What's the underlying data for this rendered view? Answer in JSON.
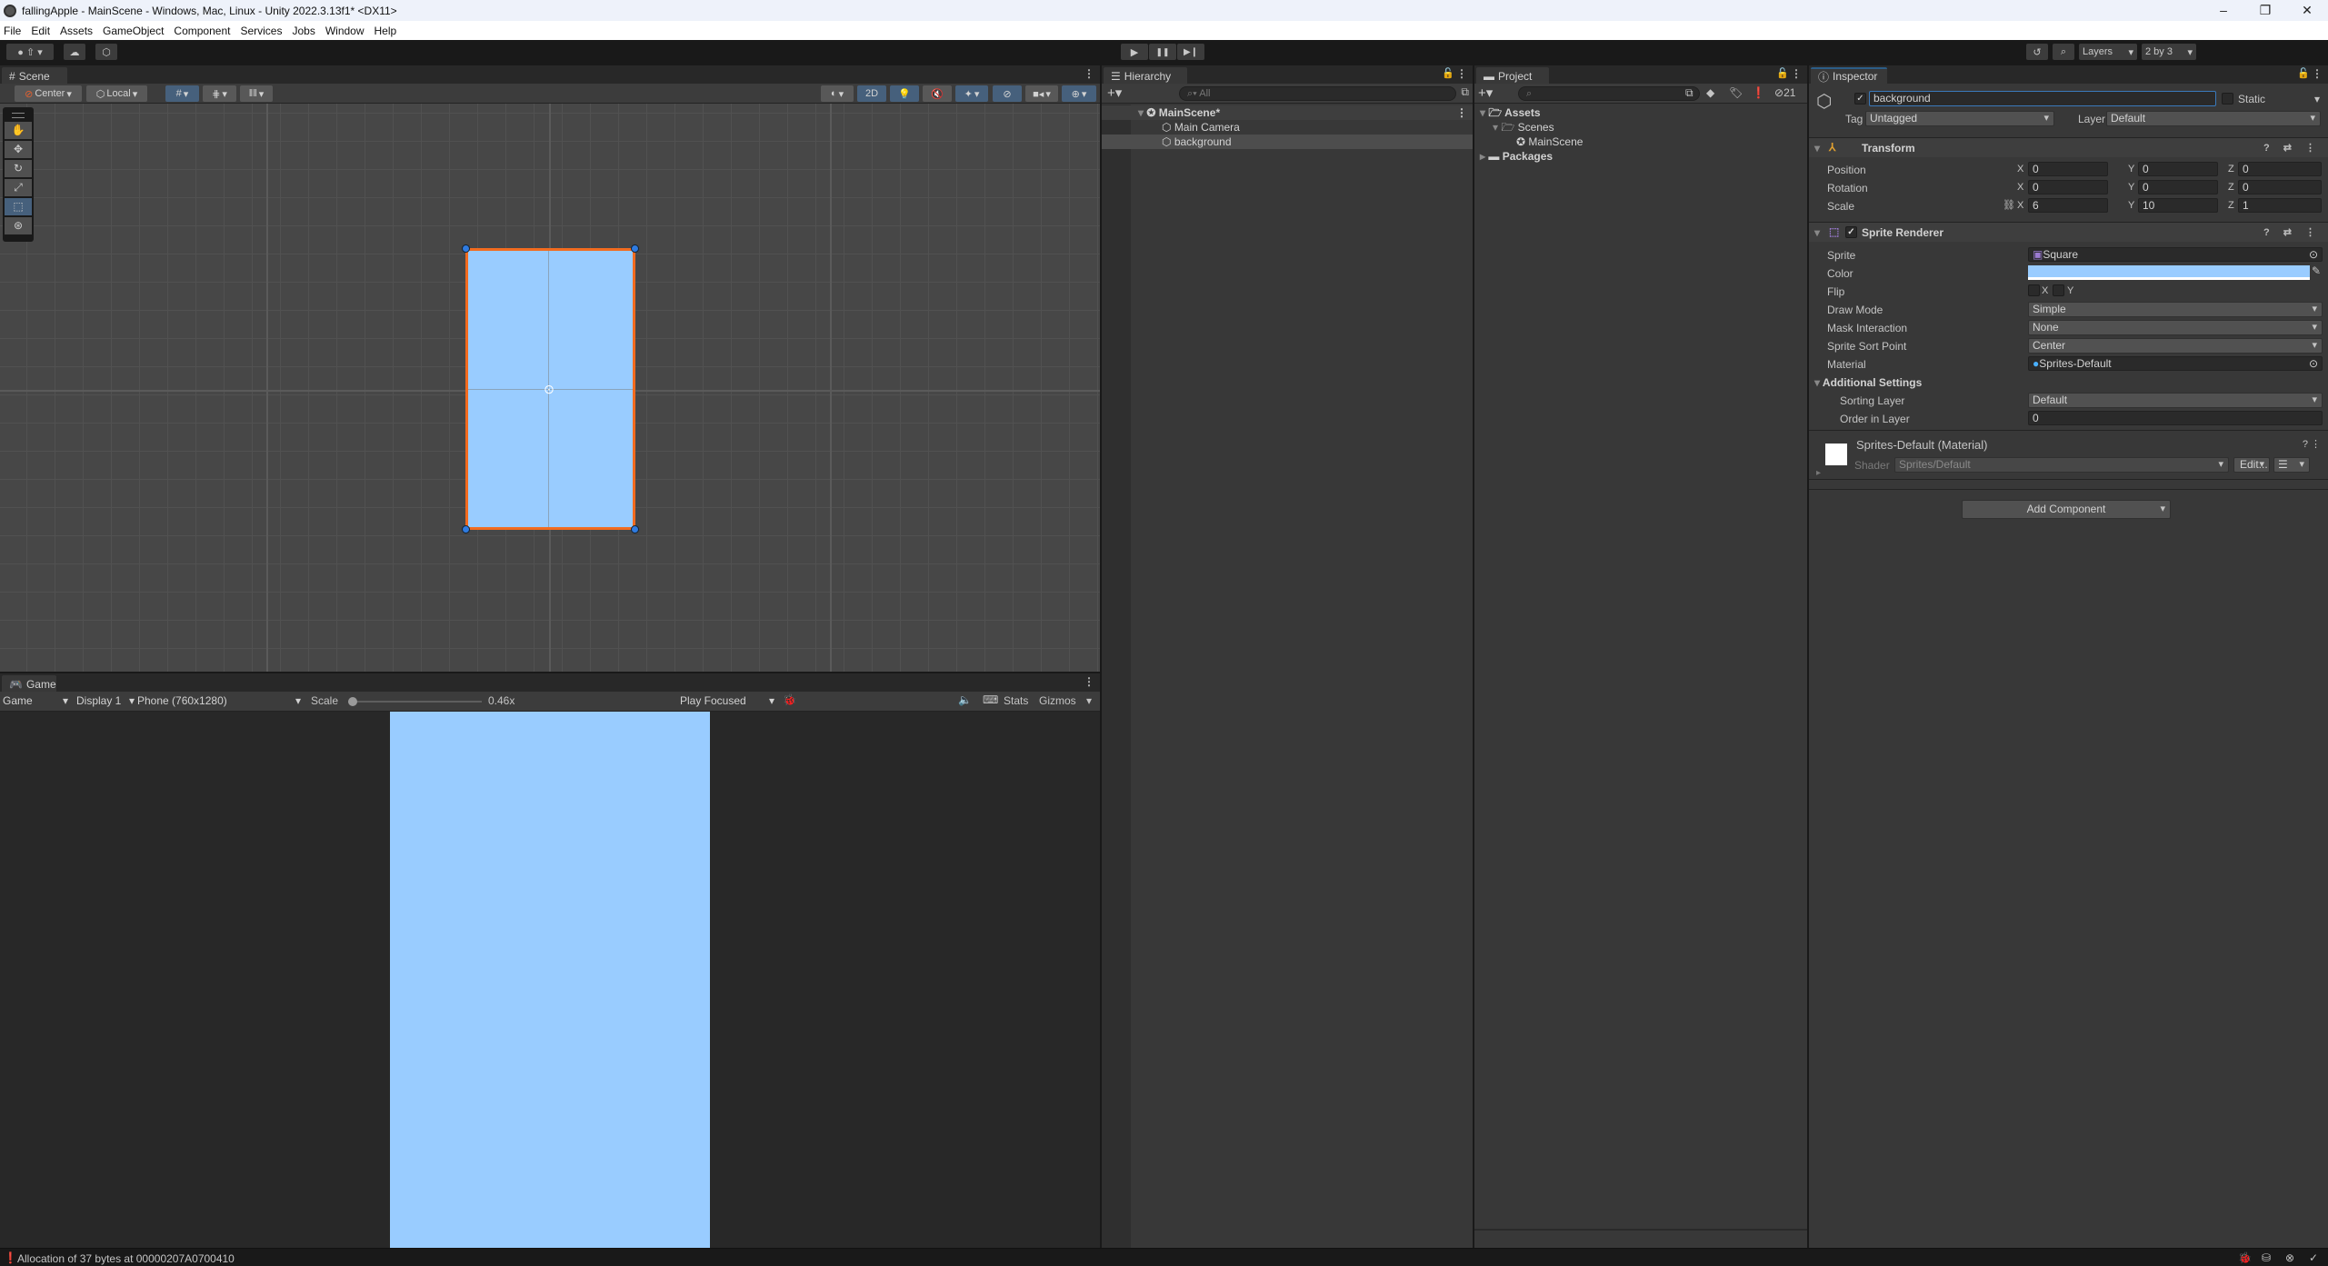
{
  "window": {
    "title": "fallingApple - MainScene - Windows, Mac, Linux - Unity 2022.3.13f1* <DX11>",
    "controls": {
      "minimize": "–",
      "maximize": "❐",
      "close": "✕"
    }
  },
  "menu": [
    "File",
    "Edit",
    "Assets",
    "GameObject",
    "Component",
    "Services",
    "Jobs",
    "Window",
    "Help"
  ],
  "toolbar": {
    "account_icon": "account-icon",
    "cloud_icon": "cloud-icon",
    "play_glyph": "▶",
    "pause_glyph": "❚❚",
    "step_glyph": "▶❙",
    "layers_label": "Layers",
    "layout_label": "2 by 3"
  },
  "scene": {
    "tab_label": "Scene",
    "pivot_label": "Center",
    "space_label": "Local",
    "mode_2d_label": "2D",
    "sprite_color": "#99ccff",
    "selection_color": "#f26b1f"
  },
  "game": {
    "tab_label": "Game",
    "view_dropdown": "Game",
    "display_dropdown": "Display 1",
    "resolution_dropdown": "Phone (760x1280)",
    "scale_label": "Scale",
    "scale_value": "0.46x",
    "scale_slider_fraction": 0.0,
    "play_mode_dropdown": "Play Focused",
    "stats_label": "Stats",
    "gizmos_label": "Gizmos",
    "background_color": "#99ccff"
  },
  "hierarchy": {
    "tab_label": "Hierarchy",
    "search_placeholder": "All",
    "scene_name": "MainScene*",
    "items": [
      {
        "label": "Main Camera",
        "selected": false
      },
      {
        "label": "background",
        "selected": true
      }
    ]
  },
  "project": {
    "tab_label": "Project",
    "search_placeholder": "",
    "hidden_count": "21",
    "tree": [
      {
        "label": "Assets",
        "bold": true,
        "expanded": true,
        "depth": 0
      },
      {
        "label": "Scenes",
        "bold": false,
        "expanded": true,
        "depth": 1
      },
      {
        "label": "MainScene",
        "bold": false,
        "expanded": null,
        "depth": 2
      },
      {
        "label": "Packages",
        "bold": true,
        "expanded": false,
        "depth": 0
      }
    ]
  },
  "inspector": {
    "tab_label": "Inspector",
    "object_name": "background",
    "active": true,
    "static_label": "Static",
    "tag_label": "Tag",
    "tag_value": "Untagged",
    "layer_label": "Layer",
    "layer_value": "Default",
    "transform": {
      "title": "Transform",
      "position_label": "Position",
      "rotation_label": "Rotation",
      "scale_label": "Scale",
      "position": {
        "x": "0",
        "y": "0",
        "z": "0"
      },
      "rotation": {
        "x": "0",
        "y": "0",
        "z": "0"
      },
      "scale": {
        "x": "6",
        "y": "10",
        "z": "1"
      }
    },
    "sprite_renderer": {
      "title": "Sprite Renderer",
      "sprite_label": "Sprite",
      "sprite_value": "Square",
      "color_label": "Color",
      "color_value": "#99ccff",
      "flip_label": "Flip",
      "flip_x": "X",
      "flip_y": "Y",
      "draw_mode_label": "Draw Mode",
      "draw_mode_value": "Simple",
      "mask_label": "Mask Interaction",
      "mask_value": "None",
      "sort_point_label": "Sprite Sort Point",
      "sort_point_value": "Center",
      "material_label": "Material",
      "material_value": "Sprites-Default",
      "additional_label": "Additional Settings",
      "sorting_layer_label": "Sorting Layer",
      "sorting_layer_value": "Default",
      "order_label": "Order in Layer",
      "order_value": "0"
    },
    "material": {
      "title": "Sprites-Default (Material)",
      "shader_label": "Shader",
      "shader_value": "Sprites/Default",
      "edit_label": "Edit..."
    },
    "add_component_label": "Add Component"
  },
  "status": {
    "message": "Allocation of 37 bytes at 00000207A0700410"
  }
}
